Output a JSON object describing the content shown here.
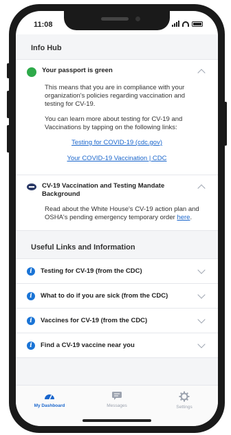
{
  "status_bar": {
    "time": "11:08"
  },
  "info_hub": {
    "title": "Info Hub",
    "passport": {
      "title": "Your passport is green",
      "paragraph1": "This means that you are in compliance with your organization's policies regarding vaccination and testing for CV-19.",
      "paragraph2": "You can learn more about testing for CV-19 and Vaccinations by tapping on the following links:",
      "link1": "Testing for COVID-19 (cdc.gov)",
      "link2": "Your COVID-19 Vaccination | CDC"
    },
    "mandate": {
      "title": "CV-19 Vaccination and Testing Mandate Background",
      "text_before": "Read about the White House's CV-19 action plan and OSHA's pending emergency temporary order ",
      "link": "here",
      "text_after": "."
    }
  },
  "useful_links": {
    "title": "Useful Links and Information",
    "items": [
      {
        "label": "Testing for CV-19 (from the CDC)"
      },
      {
        "label": "What to do if you are sick (from the CDC)"
      },
      {
        "label": "Vaccines for CV-19 (from the CDC)"
      },
      {
        "label": "Find a CV-19 vaccine near you"
      }
    ]
  },
  "tab_bar": {
    "tabs": [
      {
        "label": "My Dashboard",
        "icon": "dashboard-icon",
        "active": true
      },
      {
        "label": "Messages",
        "icon": "message-icon",
        "active": false
      },
      {
        "label": "Settings",
        "icon": "gear-icon",
        "active": false
      }
    ]
  },
  "colors": {
    "passport_status": "#2eaa4a",
    "link": "#1a66cc",
    "info_icon": "#1a74d6",
    "active_tab": "#1a66cc"
  }
}
